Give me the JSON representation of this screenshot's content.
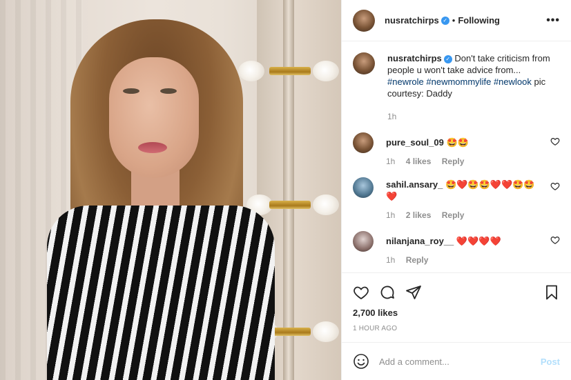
{
  "post": {
    "author": "nusratchirps",
    "separator": "•",
    "follow_status": "Following",
    "more_icon": "more-horizontal-icon",
    "verified_icon": "verified-badge-icon"
  },
  "caption": {
    "username": "nusratchirps",
    "text_before": " Don't take criticism from people u won't take advice from... ",
    "tags": [
      "#newrole",
      "#newmommylife",
      "#newlook"
    ],
    "text_after": " pic courtesy: Daddy",
    "time": "1h"
  },
  "comments": [
    {
      "username": "pure_soul_09",
      "text": "🤩🤩",
      "time": "1h",
      "likes": "4 likes",
      "reply": "Reply"
    },
    {
      "username": "sahil.ansary_",
      "text": "🤩❤️🤩🤩❤️❤️🤩🤩❤️",
      "time": "1h",
      "likes": "2 likes",
      "reply": "Reply"
    },
    {
      "username": "nilanjana_roy__",
      "text": "❤️❤️❤️❤️",
      "time": "1h",
      "likes": "",
      "reply": "Reply"
    }
  ],
  "actions": {
    "like_icon": "heart-icon",
    "comment_icon": "comment-icon",
    "share_icon": "share-icon",
    "save_icon": "bookmark-icon"
  },
  "likes_count": "2,700 likes",
  "posted_ago": "1 HOUR AGO",
  "add_comment": {
    "placeholder": "Add a comment...",
    "post_label": "Post",
    "emoji_icon": "emoji-icon"
  },
  "colors": {
    "hashtag": "#00376b",
    "verified": "#3897f0",
    "post_button_disabled": "#b2dffc",
    "muted_text": "#8e8e8e"
  }
}
